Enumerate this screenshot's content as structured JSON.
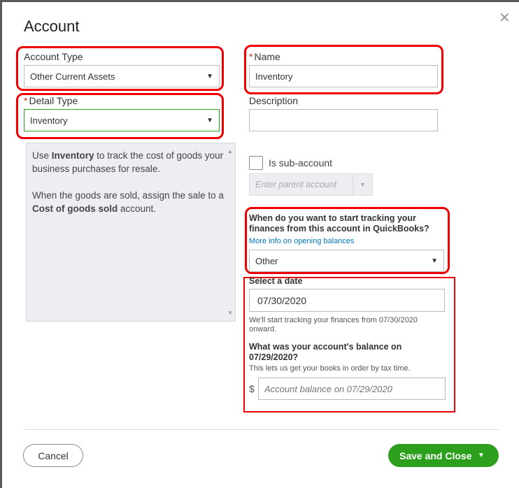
{
  "dialog": {
    "title": "Account",
    "close_icon": "close-icon"
  },
  "account_type": {
    "label": "Account Type",
    "value": "Other Current Assets"
  },
  "detail_type": {
    "label": "Detail Type",
    "value": "Inventory"
  },
  "name": {
    "label": "Name",
    "value": "Inventory"
  },
  "description": {
    "label": "Description",
    "value": ""
  },
  "help": {
    "p1_a": "Use ",
    "p1_b": "Inventory",
    "p1_c": " to track the cost of goods your business purchases for resale.",
    "p2_a": "When the goods are sold, assign the sale to a ",
    "p2_b": "Cost of goods sold",
    "p2_c": " account."
  },
  "sub_account": {
    "label": "Is sub-account",
    "checked": false,
    "parent_placeholder": "Enter parent account"
  },
  "tracking": {
    "question": "When do you want to start tracking your finances from this account in QuickBooks?",
    "link": "More info on opening balances",
    "value": "Other"
  },
  "date": {
    "label": "Select a date",
    "value": "07/30/2020",
    "note": "We'll start tracking your finances from 07/30/2020 onward."
  },
  "balance": {
    "question": "What was your account's balance on 07/29/2020?",
    "note": "This lets us get your books in order by tax time.",
    "currency": "$",
    "placeholder": "Account balance on 07/29/2020"
  },
  "footer": {
    "cancel": "Cancel",
    "save": "Save and Close"
  },
  "colors": {
    "green": "#2ca01c",
    "highlight": "#e00000",
    "link": "#0077c5"
  }
}
